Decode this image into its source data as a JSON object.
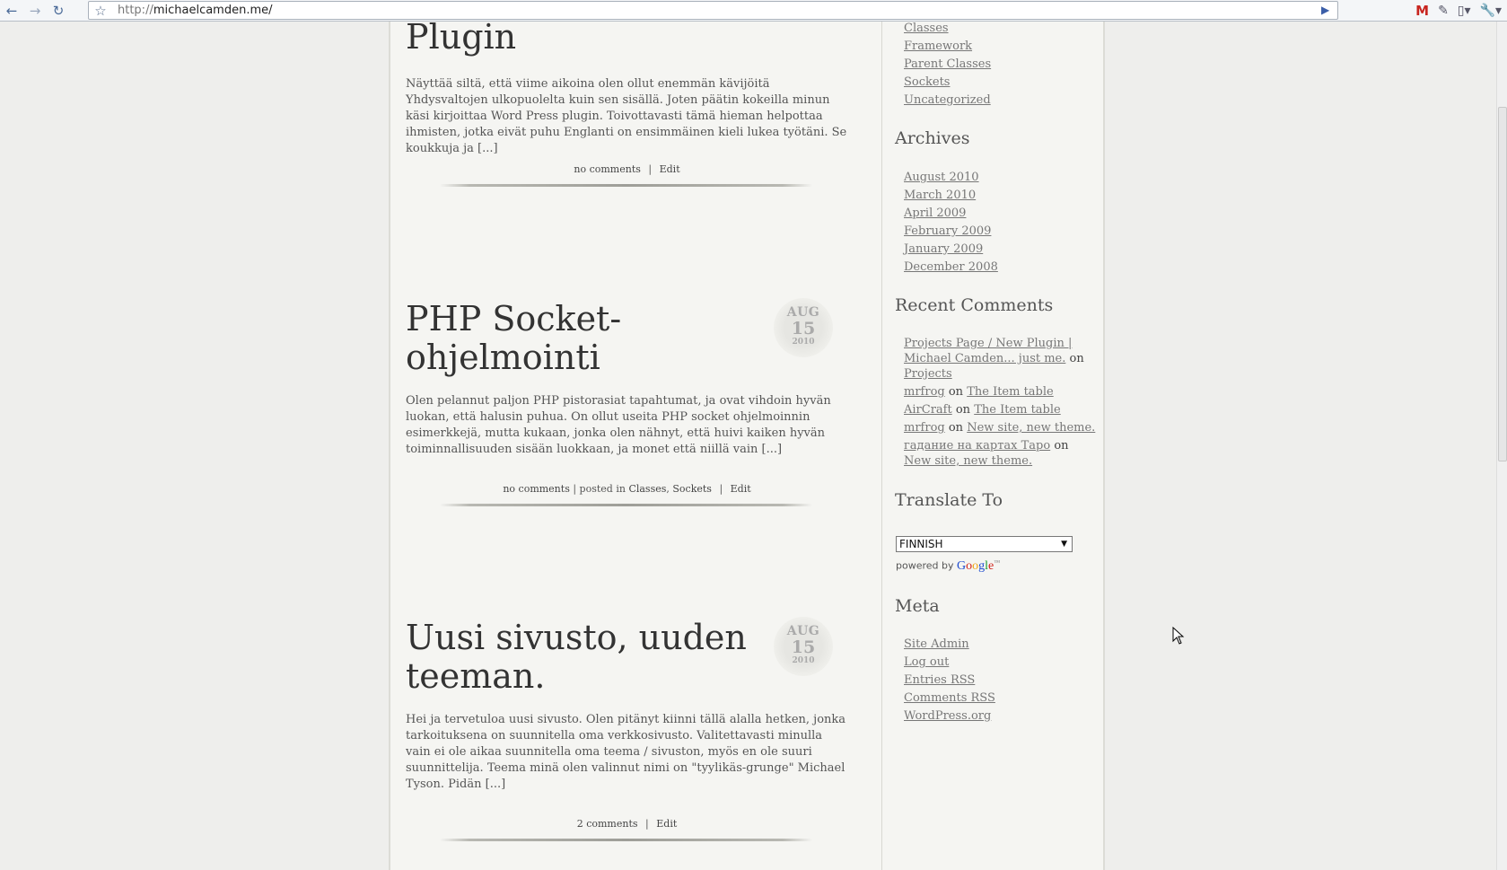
{
  "browser": {
    "url_scheme": "http://",
    "url_host": "michaelcamden.me/",
    "back_icon": "←",
    "forward_icon": "→",
    "reload_icon": "↻",
    "star_icon": "☆",
    "go_icon": "▶",
    "gmail_icon": "M",
    "pencil_icon": "✎",
    "page_icon": "▯▾",
    "wrench_icon": "🔧▾"
  },
  "posts": [
    {
      "title": "Plugin",
      "excerpt": "Näyttää siltä, että viime aikoina olen ollut enemmän kävijöitä Yhdysvaltojen ulkopuolelta kuin sen sisällä. Joten päätin kokeilla minun käsi kirjoittaa Word Press plugin. Toivottavasti tämä hieman helpottaa ihmisten, jotka eivät puhu Englanti on ensimmäinen kieli lukea työtäni. Se koukkuja ja [...]",
      "comments": "no comments",
      "sep": "|",
      "edit": "Edit"
    },
    {
      "title": "PHP Socket-ohjelmointi",
      "date_month": "AUG",
      "date_day": "15",
      "date_year": "2010",
      "excerpt": "Olen pelannut paljon PHP pistorasiat tapahtumat, ja ovat vihdoin hyvän luokan, että halusin puhua. On ollut useita PHP socket ohjelmoinnin esimerkkejä, mutta kukaan, jonka olen nähnyt, että huivi kaiken hyvän toiminnallisuuden sisään luokkaan, ja monet että niillä vain [...]",
      "comments": "no comments",
      "posted_in": "| posted in",
      "cat1": "Classes",
      "cat_sep": ",",
      "cat2": "Sockets",
      "sep": "|",
      "edit": "Edit"
    },
    {
      "title": "Uusi sivusto, uuden teeman.",
      "date_month": "AUG",
      "date_day": "15",
      "date_year": "2010",
      "excerpt": "Hei ja tervetuloa uusi sivusto. Olen pitänyt kiinni tällä alalla hetken, jonka tarkoituksena on suunnitella oma verkkosivusto. Valitettavasti minulla vain ei ole aikaa suunnitella oma teema / sivuston, myös en ole suuri suunnittelija. Teema minä olen valinnut nimi on \"tyylikäs-grunge\" Michael Tyson. Pidän [...]",
      "comments": "2 comments",
      "sep": "|",
      "edit": "Edit"
    }
  ],
  "sidebar": {
    "categories": [
      "Classes",
      "Framework",
      "Parent Classes",
      "Sockets",
      "Uncategorized"
    ],
    "archives_heading": "Archives",
    "archives": [
      "August 2010",
      "March 2010",
      "April 2009",
      "February 2009",
      "January 2009",
      "December 2008"
    ],
    "recent_comments_heading": "Recent Comments",
    "recent_comments": [
      {
        "author": "Projects Page / New Plugin | Michael Camden... just me.",
        "on": "on",
        "post": "Projects"
      },
      {
        "author": "mrfrog",
        "on": "on",
        "post": "The Item table"
      },
      {
        "author": "AirCraft",
        "on": "on",
        "post": "The Item table"
      },
      {
        "author": "mrfrog",
        "on": "on",
        "post": "New site, new theme."
      },
      {
        "author": "гадание на картах Таро",
        "on": "on",
        "post": "New site, new theme."
      }
    ],
    "translate_heading": "Translate To",
    "translate_selected": "FINNISH",
    "powered_by": "powered by",
    "google_letters": [
      "G",
      "o",
      "o",
      "g",
      "l",
      "e"
    ],
    "google_tm": "™",
    "meta_heading": "Meta",
    "meta": [
      "Site Admin",
      "Log out",
      "Entries RSS",
      "Comments RSS",
      "WordPress.org"
    ]
  }
}
